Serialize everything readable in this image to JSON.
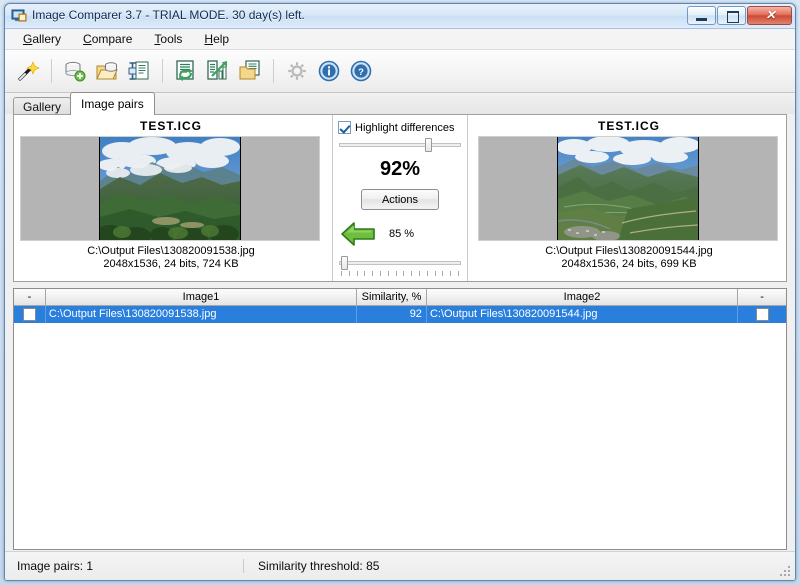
{
  "window": {
    "title": "Image Comparer 3.7 - TRIAL MODE. 30 day(s) left.",
    "icon": "app-icon",
    "minimize_label": "–",
    "maximize_label": "□",
    "close_label": "✕"
  },
  "menu": {
    "items": [
      {
        "label": "Gallery",
        "accel": "G"
      },
      {
        "label": "Compare",
        "accel": "C"
      },
      {
        "label": "Tools",
        "accel": "T"
      },
      {
        "label": "Help",
        "accel": "H"
      }
    ]
  },
  "toolbar": {
    "buttons": [
      {
        "name": "magic-wand-icon",
        "tip": "Wizard"
      },
      {
        "name": "new-gallery-icon",
        "tip": "New gallery"
      },
      {
        "name": "open-folder-icon",
        "tip": "Open gallery"
      },
      {
        "name": "compress-icon",
        "tip": "Compress"
      },
      {
        "name": "refresh-compare-icon",
        "tip": "Compare"
      },
      {
        "name": "chart-report-icon",
        "tip": "Results"
      },
      {
        "name": "folder-document-icon",
        "tip": "Export"
      },
      {
        "name": "gear-icon",
        "tip": "Options"
      },
      {
        "name": "info-icon",
        "tip": "About"
      },
      {
        "name": "help-icon",
        "tip": "Help"
      }
    ]
  },
  "tabs": [
    {
      "label": "Gallery",
      "active": false
    },
    {
      "label": "Image pairs",
      "active": true
    }
  ],
  "compare": {
    "left": {
      "title": "TEST.ICG",
      "path": "C:\\Output Files\\130820091538.jpg",
      "info": "2048x1536, 24 bits, 724 KB"
    },
    "right": {
      "title": "TEST.ICG",
      "path": "C:\\Output Files\\130820091544.jpg",
      "info": "2048x1536, 24 bits, 699 KB"
    },
    "highlight_differences": {
      "label": "Highlight differences",
      "checked": true
    },
    "similarity_percent": "92%",
    "actions_label": "Actions",
    "threshold_label": "85 %",
    "zoom_slider_value": 75,
    "threshold_slider_value": 2,
    "arrow_icon": "green-left-arrow-icon"
  },
  "grid": {
    "columns": [
      "-",
      "Image1",
      "Similarity, %",
      "Image2",
      "-"
    ],
    "rows": [
      {
        "checked_left": false,
        "image1": "C:\\Output Files\\130820091538.jpg",
        "similarity": "92",
        "image2": "C:\\Output Files\\130820091544.jpg",
        "checked_right": false,
        "selected": true
      }
    ]
  },
  "status": {
    "pairs": "Image pairs: 1",
    "threshold": "Similarity threshold: 85"
  },
  "colors": {
    "selection": "#2a7fdd",
    "accent_green": "#57b544",
    "title_text": "#0c2c50"
  }
}
